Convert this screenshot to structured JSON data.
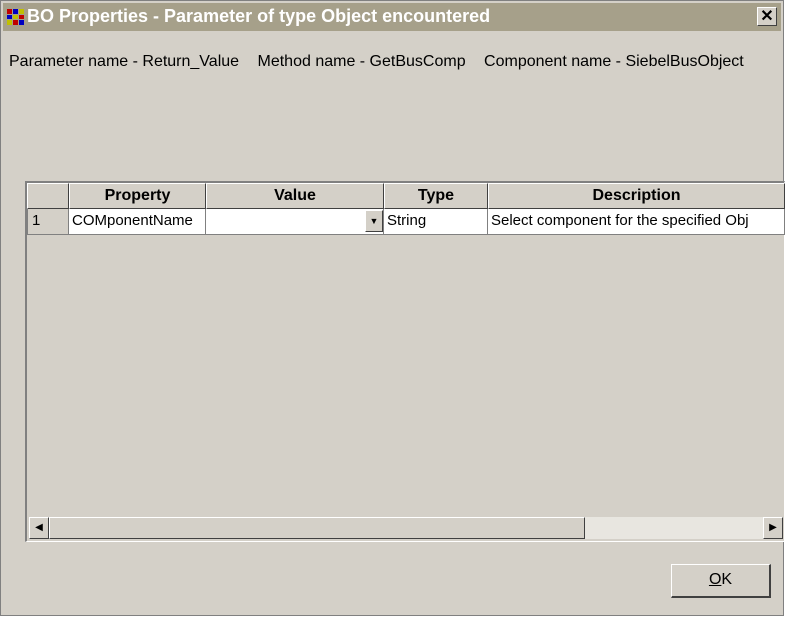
{
  "window": {
    "title": "BO Properties - Parameter of type Object encountered",
    "close_label": "✕",
    "icon": "app-grid-icon"
  },
  "param_info": {
    "parameter": "Parameter name - Return_Value",
    "method": "Method name - GetBusComp",
    "component": "Component name - SiebelBusObject"
  },
  "grid": {
    "columns": [
      "",
      "Property",
      "Value",
      "Type",
      "Description"
    ],
    "rows": [
      {
        "num": "1",
        "property": "COMponentName",
        "value": "",
        "type": "String",
        "description": "Select component for the specified Obj"
      }
    ]
  },
  "buttons": {
    "ok_accel": "O",
    "ok_rest": "K"
  },
  "icons": {
    "dropdown": "chevron-down-icon",
    "scroll_left": "scroll-left-icon",
    "scroll_right": "scroll-right-icon"
  }
}
